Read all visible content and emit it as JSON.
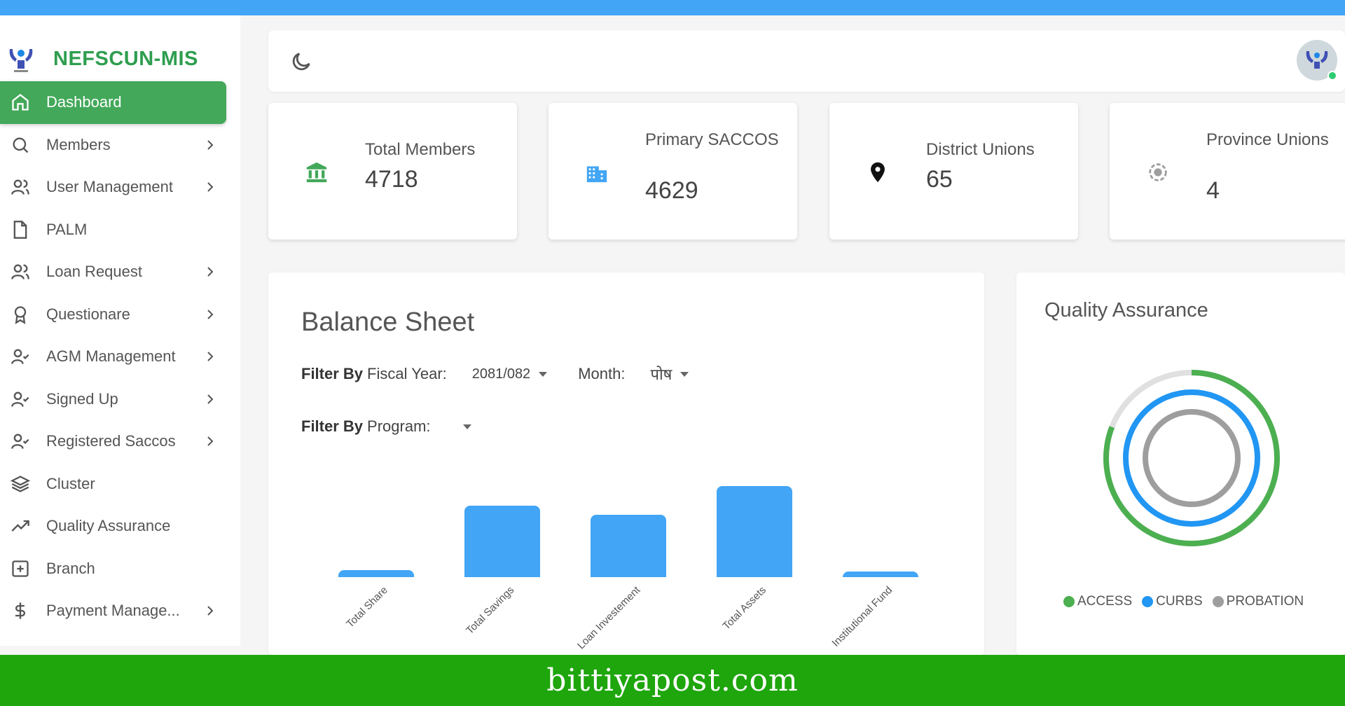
{
  "app": {
    "name": "NEFSCUN-MIS"
  },
  "sidebar": {
    "items": [
      {
        "label": "Dashboard",
        "icon": "home-icon",
        "active": true,
        "has_submenu": false
      },
      {
        "label": "Members",
        "icon": "search-icon",
        "has_submenu": true
      },
      {
        "label": "User Management",
        "icon": "users-icon",
        "has_submenu": true
      },
      {
        "label": "PALM",
        "icon": "file-icon",
        "has_submenu": false
      },
      {
        "label": "Loan Request",
        "icon": "users-icon",
        "has_submenu": true
      },
      {
        "label": "Questionare",
        "icon": "award-icon",
        "has_submenu": true
      },
      {
        "label": "AGM Management",
        "icon": "user-check-icon",
        "has_submenu": true
      },
      {
        "label": "Signed Up",
        "icon": "user-check-icon",
        "has_submenu": true
      },
      {
        "label": "Registered Saccos",
        "icon": "user-check-icon",
        "has_submenu": true
      },
      {
        "label": "Cluster",
        "icon": "layers-icon",
        "has_submenu": false
      },
      {
        "label": "Quality Assurance",
        "icon": "trending-up-icon",
        "has_submenu": false
      },
      {
        "label": "Branch",
        "icon": "plus-square-icon",
        "has_submenu": false
      },
      {
        "label": "Payment Manage...",
        "icon": "dollar-icon",
        "has_submenu": true
      }
    ]
  },
  "header": {
    "theme_toggle_icon": "moon-icon",
    "avatar_status": "online"
  },
  "stats": [
    {
      "label": "Total Members",
      "value": "4718",
      "icon": "bank-icon",
      "color": "#43a85a"
    },
    {
      "label": "Primary SACCOS",
      "value": "4629",
      "icon": "building-icon",
      "color": "#42a5f5"
    },
    {
      "label": "District Unions",
      "value": "65",
      "icon": "map-pin-icon",
      "color": "#111111"
    },
    {
      "label": "Province Unions",
      "value": "4",
      "icon": "target-icon",
      "color": "#9e9e9e"
    }
  ],
  "balance_sheet": {
    "title": "Balance Sheet",
    "filter_fiscal_bold": "Filter By",
    "filter_fiscal_label": "Fiscal Year:",
    "fiscal_year": "2081/082",
    "month_label": "Month:",
    "month": "पोष",
    "filter_program_bold": "Filter By",
    "filter_program_label": "Program:"
  },
  "quality": {
    "title": "Quality Assurance",
    "legend": [
      {
        "label": "ACCESS",
        "color": "#4caf50"
      },
      {
        "label": "CURBS",
        "color": "#2196f3"
      },
      {
        "label": "PROBATION",
        "color": "#9e9e9e"
      }
    ]
  },
  "chart_data": {
    "type": "bar",
    "categories": [
      "Total Share",
      "Total Savings",
      "Loan Investement",
      "Total Assets",
      "Institutional Fund"
    ],
    "values": [
      8,
      82,
      72,
      105,
      5
    ],
    "title": "",
    "xlabel": "",
    "ylabel": "",
    "color": "#42a5f5"
  },
  "footer": {
    "text": "bittiyapost.com"
  }
}
